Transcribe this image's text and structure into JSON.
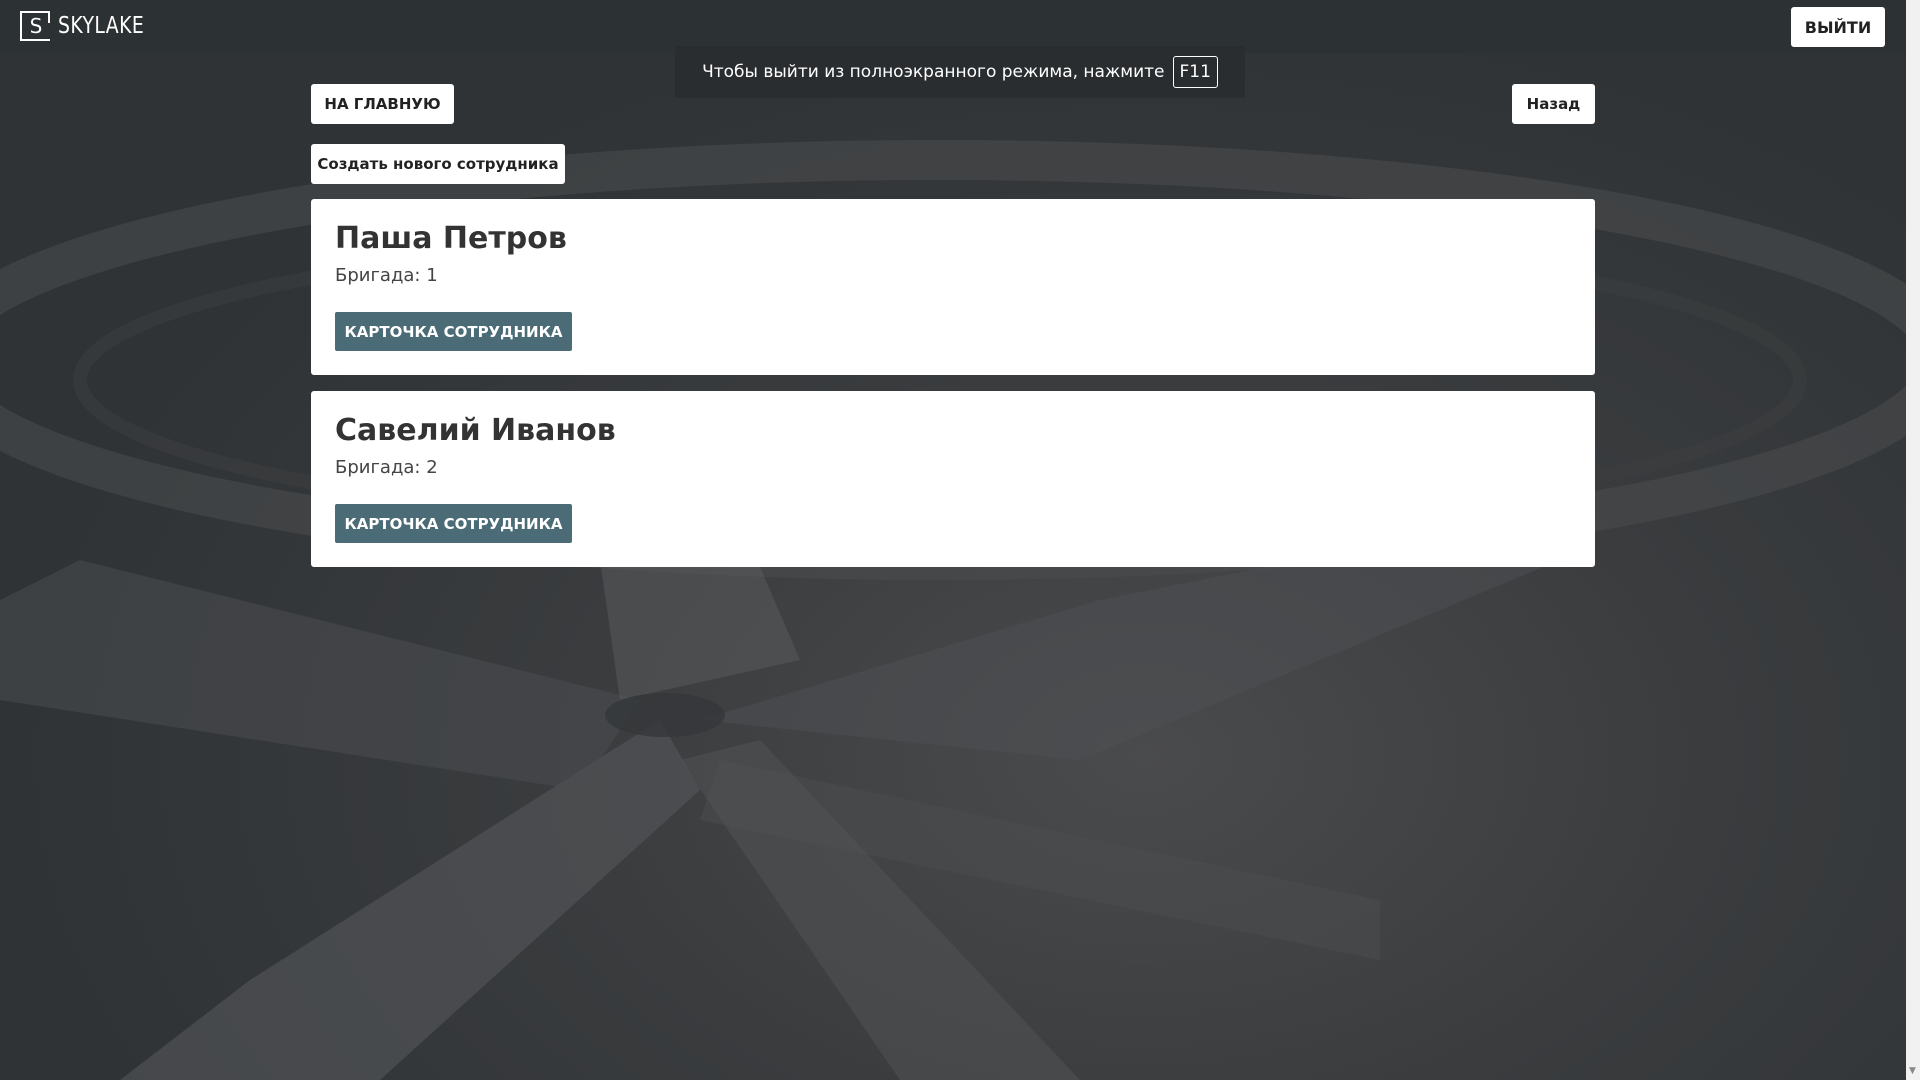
{
  "header": {
    "logo_letter": "S",
    "logo_text": "SKYLAKE",
    "logout_label": "ВЫЙТИ"
  },
  "fullscreen_notice": {
    "text": "Чтобы выйти из полноэкранного режима, нажмите",
    "key": "F11"
  },
  "nav": {
    "home_label": "НА ГЛАВНУЮ",
    "back_label": "Назад",
    "create_label": "Создать нового сотрудника"
  },
  "employees": [
    {
      "name": "Паша Петров",
      "team": "Бригада: 1",
      "card_label": "КАРТОЧКА СОТРУДНИКА"
    },
    {
      "name": "Савелий Иванов",
      "team": "Бригада: 2",
      "card_label": "КАРТОЧКА СОТРУДНИКА"
    }
  ],
  "colors": {
    "background": "#2f3336",
    "card_button": "#4b6b77"
  }
}
